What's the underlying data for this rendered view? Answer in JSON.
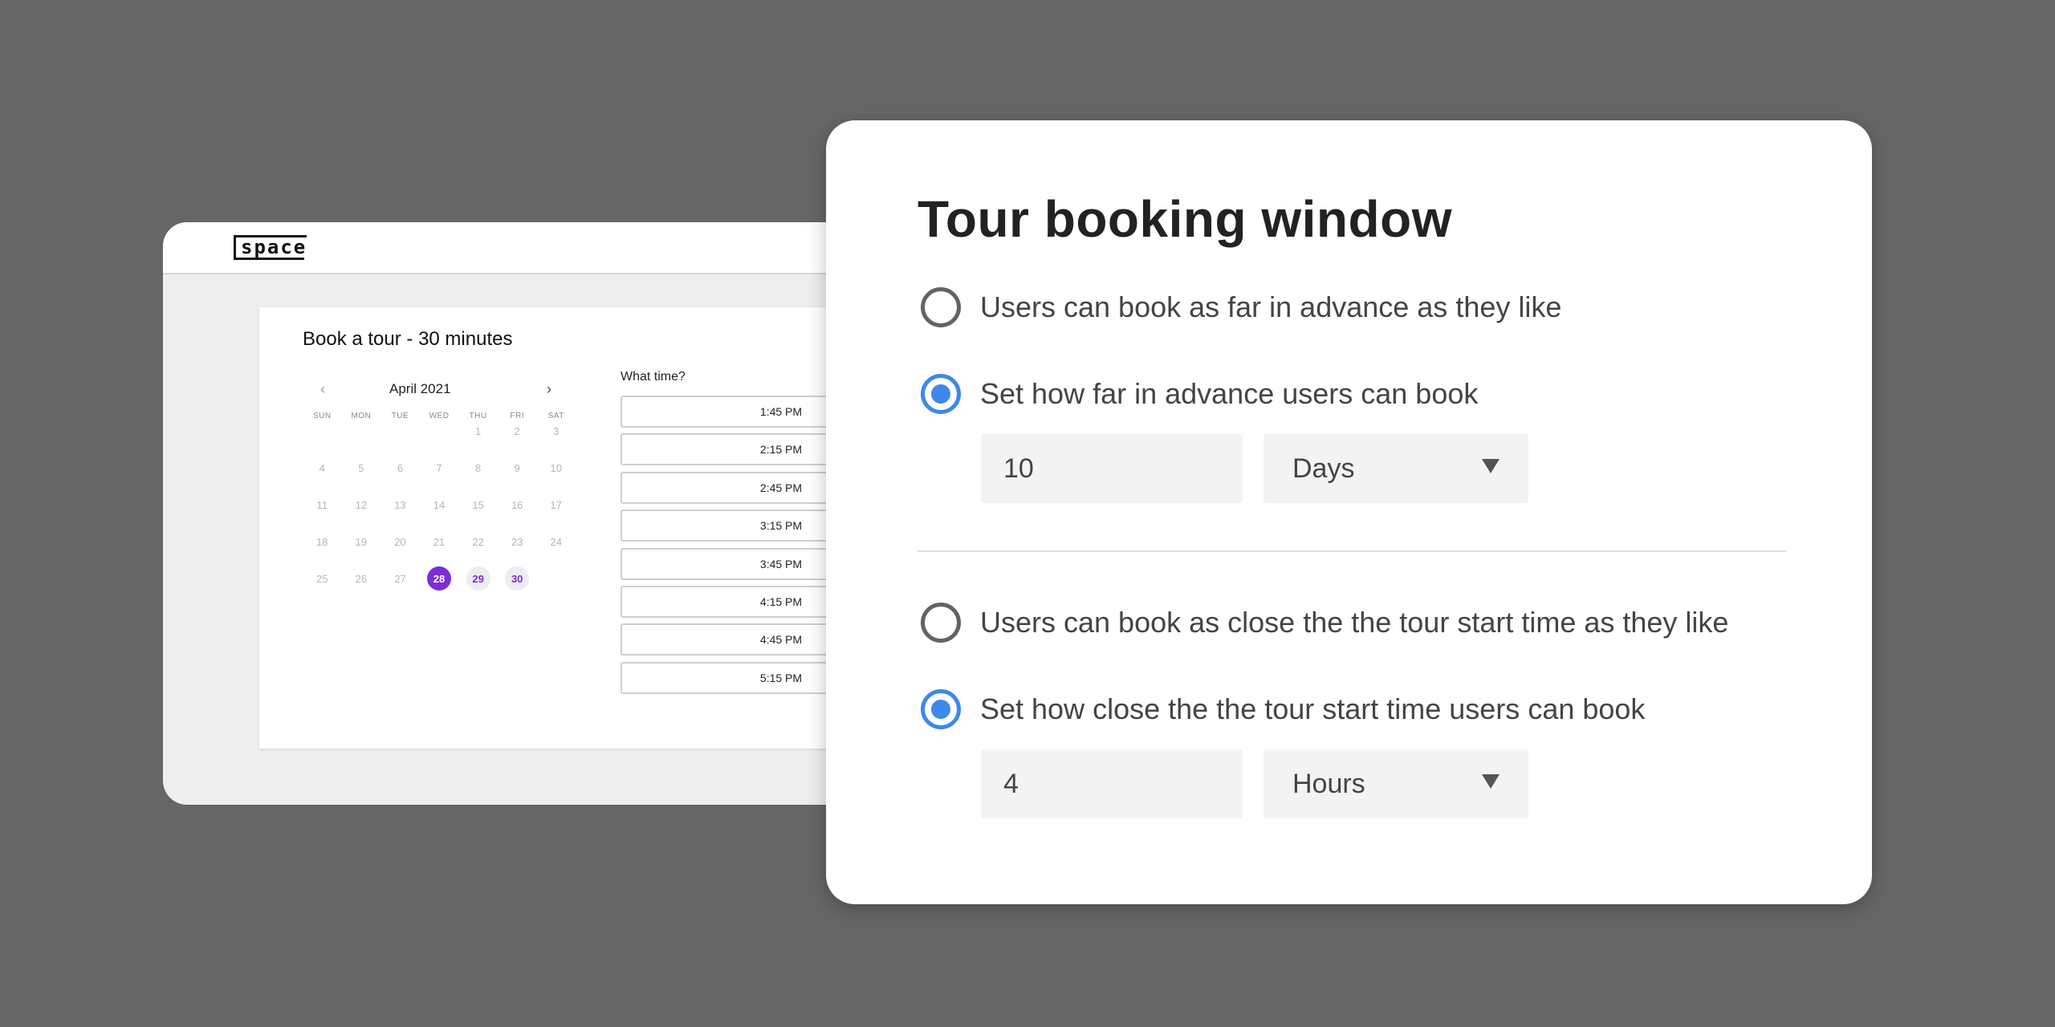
{
  "back": {
    "logo": "space",
    "title": "Book a tour - 30 minutes",
    "calendar": {
      "month": "April 2021",
      "prev_icon": "‹",
      "next_icon": "›",
      "weekdays": [
        "SUN",
        "MON",
        "TUE",
        "WED",
        "THU",
        "FRI",
        "SAT"
      ],
      "weeks": [
        [
          "",
          "",
          "",
          "",
          "1",
          "2",
          "3"
        ],
        [
          "4",
          "5",
          "6",
          "7",
          "8",
          "9",
          "10"
        ],
        [
          "11",
          "12",
          "13",
          "14",
          "15",
          "16",
          "17"
        ],
        [
          "18",
          "19",
          "20",
          "21",
          "22",
          "23",
          "24"
        ],
        [
          "25",
          "26",
          "27",
          "28",
          "29",
          "30",
          ""
        ]
      ],
      "selected_day": "28",
      "available_days": [
        "29",
        "30"
      ],
      "selected_color": "#7a2fd6"
    },
    "time_label": "What time?",
    "times": [
      "1:45 PM",
      "2:15 PM",
      "2:45 PM",
      "3:15 PM",
      "3:45 PM",
      "4:15 PM",
      "4:45 PM",
      "5:15 PM"
    ]
  },
  "panel": {
    "title": "Tour booking window",
    "advance": {
      "option1": "Users can book as far in advance as they like",
      "option2": "Set how far in advance users can book",
      "selected": 2,
      "value": "10",
      "unit": "Days"
    },
    "close": {
      "option1": "Users can book as close the the tour start time as they like",
      "option2": "Set how close the the tour start time users can book",
      "selected": 2,
      "value": "4",
      "unit": "Hours"
    },
    "accent": "#3d88ea"
  }
}
